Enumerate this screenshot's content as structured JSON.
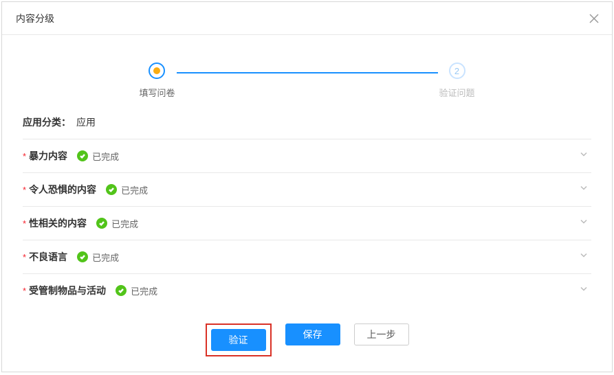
{
  "modal": {
    "title": "内容分级",
    "close_icon": "close"
  },
  "stepper": {
    "steps": [
      {
        "label": "填写问卷",
        "state": "active"
      },
      {
        "label": "验证问题",
        "state": "pending",
        "number": "2"
      }
    ]
  },
  "category": {
    "label": "应用分类：",
    "value": "应用"
  },
  "sections": [
    {
      "title": "暴力内容",
      "status_text": "已完成",
      "completed": true
    },
    {
      "title": "令人恐惧的内容",
      "status_text": "已完成",
      "completed": true
    },
    {
      "title": "性相关的内容",
      "status_text": "已完成",
      "completed": true
    },
    {
      "title": "不良语言",
      "status_text": "已完成",
      "completed": true
    },
    {
      "title": "受管制物品与活动",
      "status_text": "已完成",
      "completed": true
    }
  ],
  "buttons": {
    "verify": "验证",
    "save": "保存",
    "prev": "上一步"
  }
}
